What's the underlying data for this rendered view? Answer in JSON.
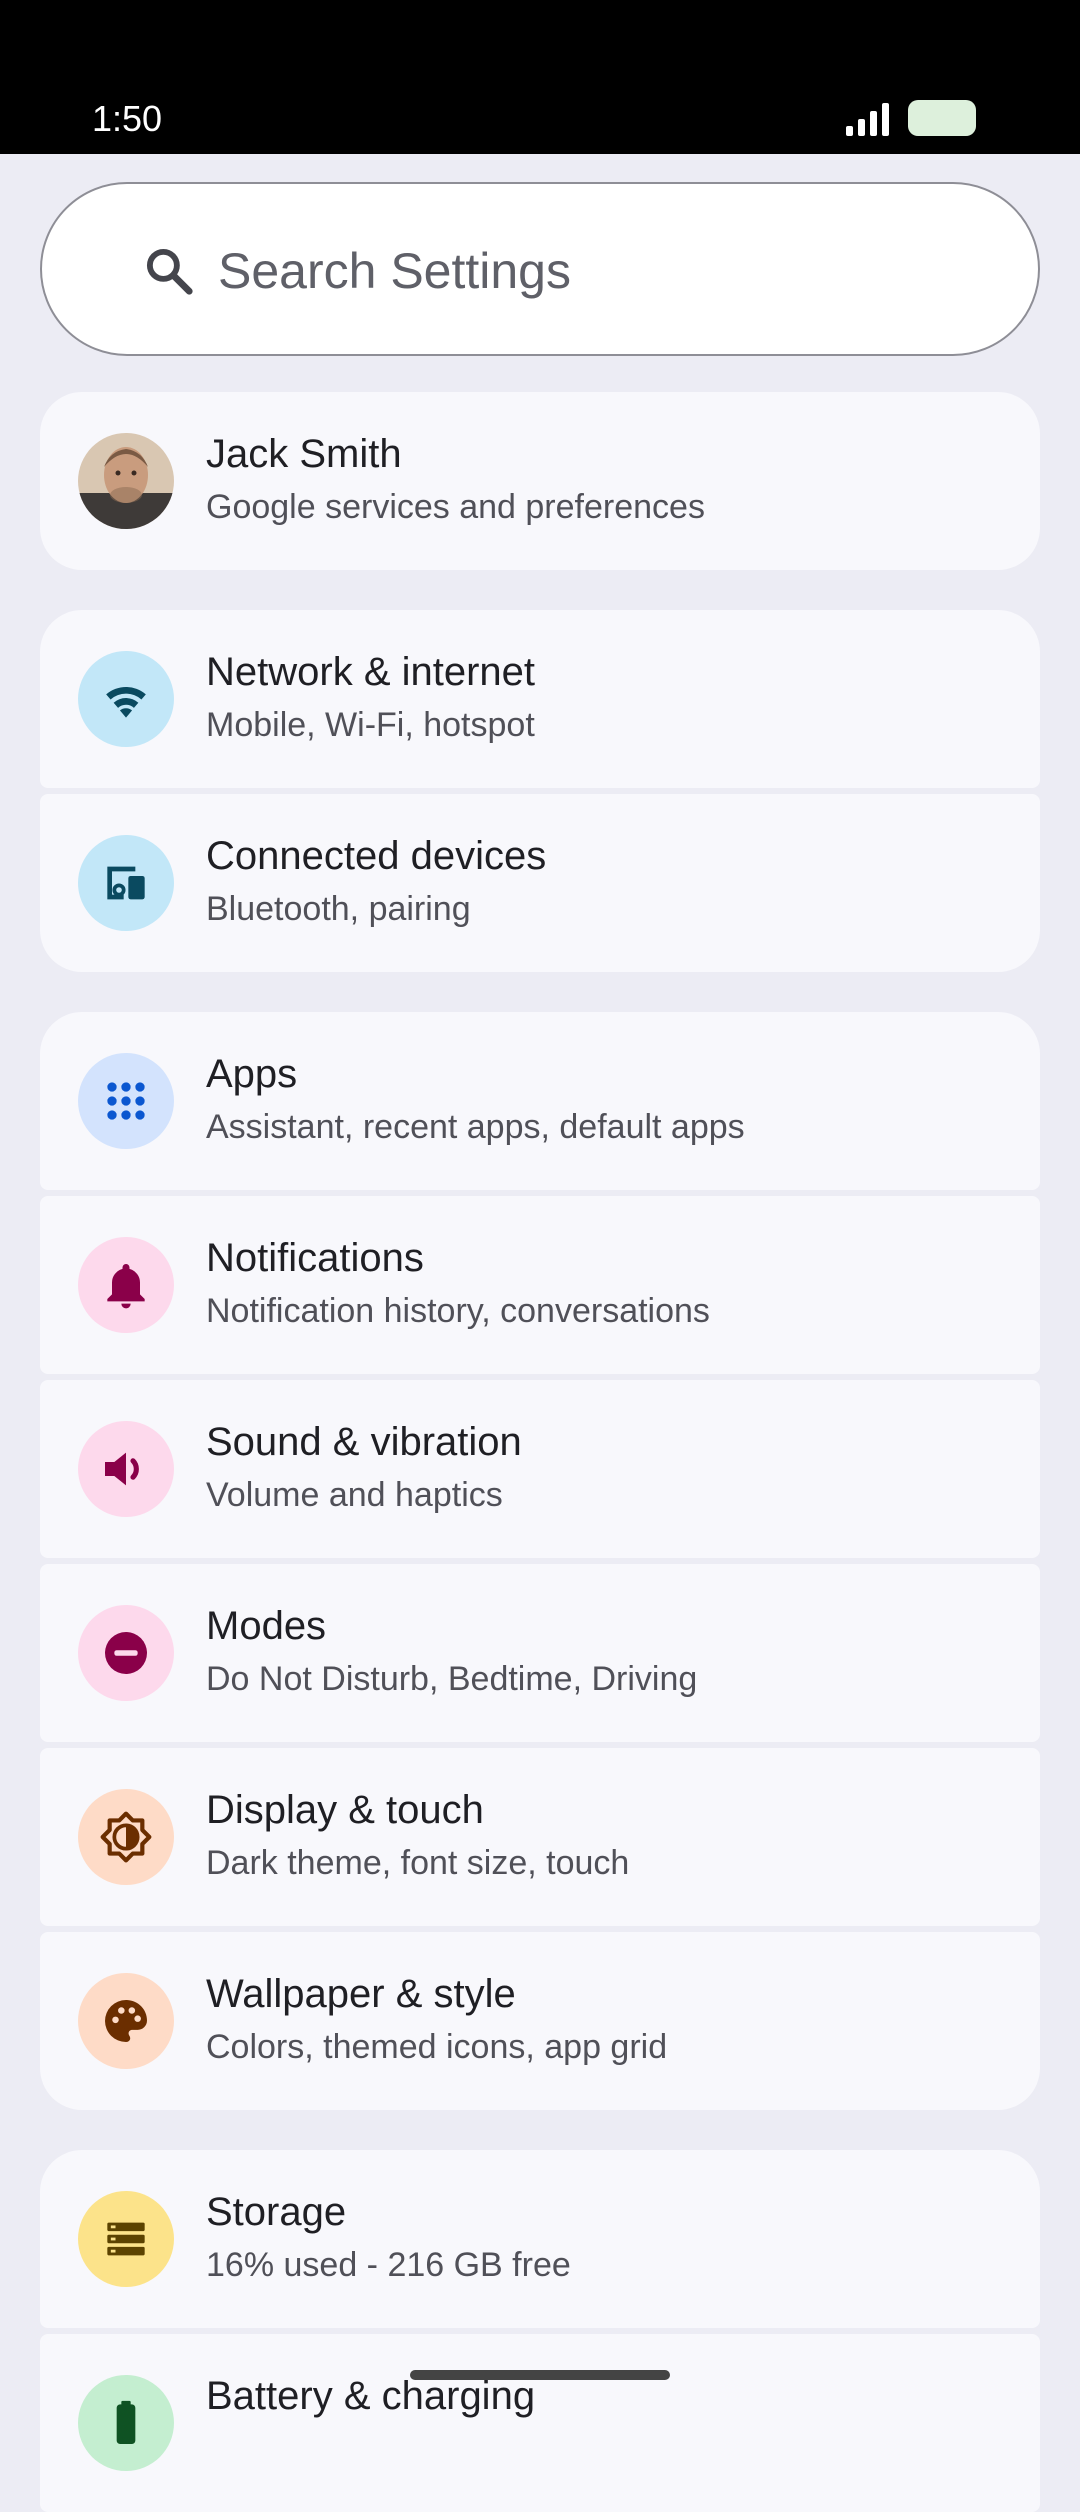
{
  "status_bar": {
    "time": "1:50"
  },
  "search": {
    "placeholder": "Search Settings"
  },
  "account": {
    "name": "Jack Smith",
    "subtitle": "Google services and preferences"
  },
  "items": [
    {
      "title": "Network & internet",
      "subtitle": "Mobile, Wi-Fi, hotspot",
      "icon": "wifi-icon",
      "bg": "#C2E7F8",
      "fg": "#0A4A60"
    },
    {
      "title": "Connected devices",
      "subtitle": "Bluetooth, pairing",
      "icon": "devices-icon",
      "bg": "#C2E7F8",
      "fg": "#0A4A60"
    },
    {
      "title": "Apps",
      "subtitle": "Assistant, recent apps, default apps",
      "icon": "apps-grid-icon",
      "bg": "#D3E3FD",
      "fg": "#0B57D0"
    },
    {
      "title": "Notifications",
      "subtitle": "Notification history, conversations",
      "icon": "bell-icon",
      "bg": "#FDD9EC",
      "fg": "#8A0049"
    },
    {
      "title": "Sound & vibration",
      "subtitle": "Volume and haptics",
      "icon": "speaker-icon",
      "bg": "#FDD9EC",
      "fg": "#8A0049"
    },
    {
      "title": "Modes",
      "subtitle": "Do Not Disturb, Bedtime, Driving",
      "icon": "do-not-disturb-icon",
      "bg": "#FDD9EC",
      "fg": "#8A0049"
    },
    {
      "title": "Display & touch",
      "subtitle": "Dark theme, font size, touch",
      "icon": "brightness-icon",
      "bg": "#FEDBC7",
      "fg": "#6B2E00"
    },
    {
      "title": "Wallpaper & style",
      "subtitle": "Colors, themed icons, app grid",
      "icon": "palette-icon",
      "bg": "#FEDBC7",
      "fg": "#6B2E00"
    },
    {
      "title": "Storage",
      "subtitle": "16% used - 216 GB free",
      "icon": "storage-icon",
      "bg": "#FCE38A",
      "fg": "#5C4300"
    },
    {
      "title": "Battery & charging",
      "subtitle": "",
      "icon": "battery-icon",
      "bg": "#C4EED0",
      "fg": "#0F5223"
    }
  ]
}
